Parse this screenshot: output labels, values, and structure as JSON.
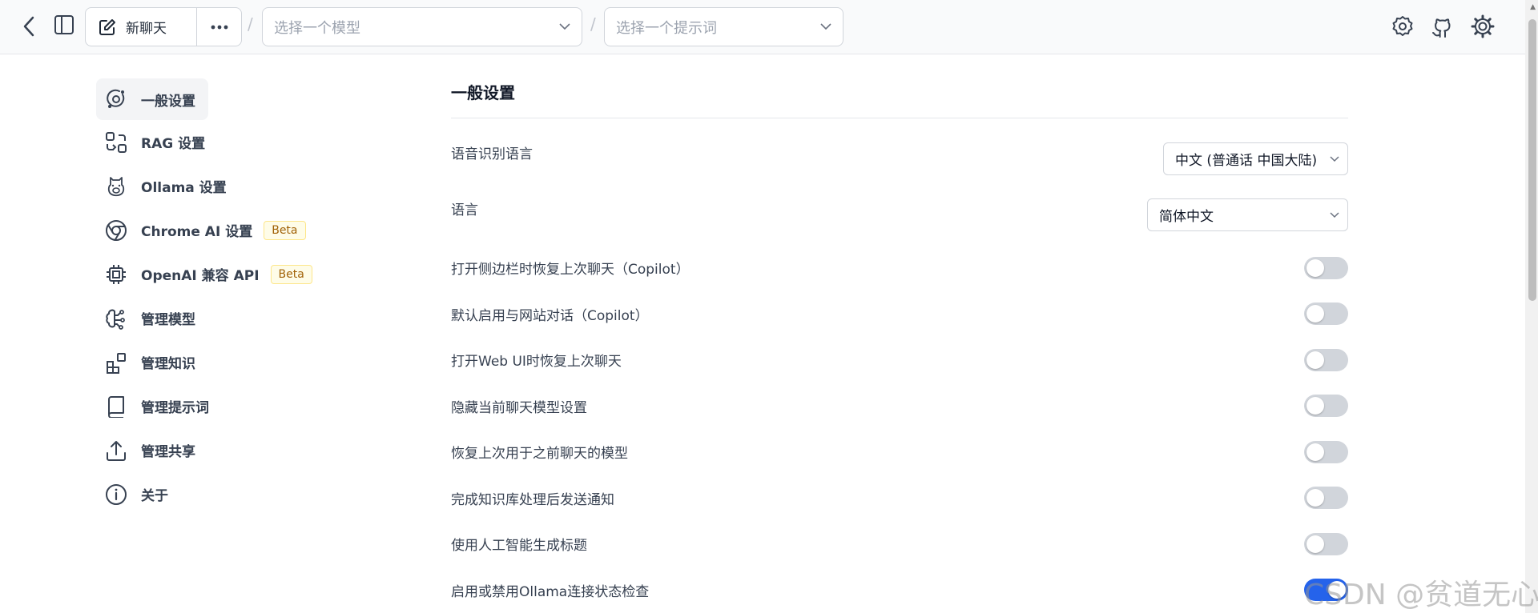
{
  "topbar": {
    "new_chat_label": "新聊天",
    "model_select_placeholder": "选择一个模型",
    "prompt_select_placeholder": "选择一个提示词",
    "separator": "/"
  },
  "nav": {
    "items": [
      {
        "label": "一般设置",
        "icon": "general-settings-icon",
        "active": true
      },
      {
        "label": "RAG 设置",
        "icon": "rag-icon"
      },
      {
        "label": "Ollama 设置",
        "icon": "llama-icon"
      },
      {
        "label": "Chrome AI 设置",
        "icon": "chrome-icon",
        "badge": "Beta"
      },
      {
        "label": "OpenAI 兼容 API",
        "icon": "cpu-chip-icon",
        "badge": "Beta"
      },
      {
        "label": "管理模型",
        "icon": "brain-icon"
      },
      {
        "label": "管理知识",
        "icon": "blocks-icon"
      },
      {
        "label": "管理提示词",
        "icon": "book-icon"
      },
      {
        "label": "管理共享",
        "icon": "share-icon"
      },
      {
        "label": "关于",
        "icon": "info-icon"
      }
    ]
  },
  "main": {
    "title": "一般设置",
    "speech_language": {
      "label": "语音识别语言",
      "value": "中文 (普通话 中国大陆)"
    },
    "language": {
      "label": "语言",
      "value": "简体中文"
    },
    "toggles": [
      {
        "label": "打开侧边栏时恢复上次聊天（Copilot）",
        "on": false
      },
      {
        "label": "默认启用与网站对话（Copilot）",
        "on": false
      },
      {
        "label": "打开Web UI时恢复上次聊天",
        "on": false
      },
      {
        "label": "隐藏当前聊天模型设置",
        "on": false
      },
      {
        "label": "恢复上次用于之前聊天的模型",
        "on": false
      },
      {
        "label": "完成知识库处理后发送通知",
        "on": false
      },
      {
        "label": "使用人工智能生成标题",
        "on": false
      },
      {
        "label": "启用或禁用Ollama连接状态检查",
        "on": true
      }
    ]
  },
  "watermark": "CSDN @贫道无心",
  "colors": {
    "accent": "#2563eb",
    "toggle_off": "#d1d5db"
  }
}
